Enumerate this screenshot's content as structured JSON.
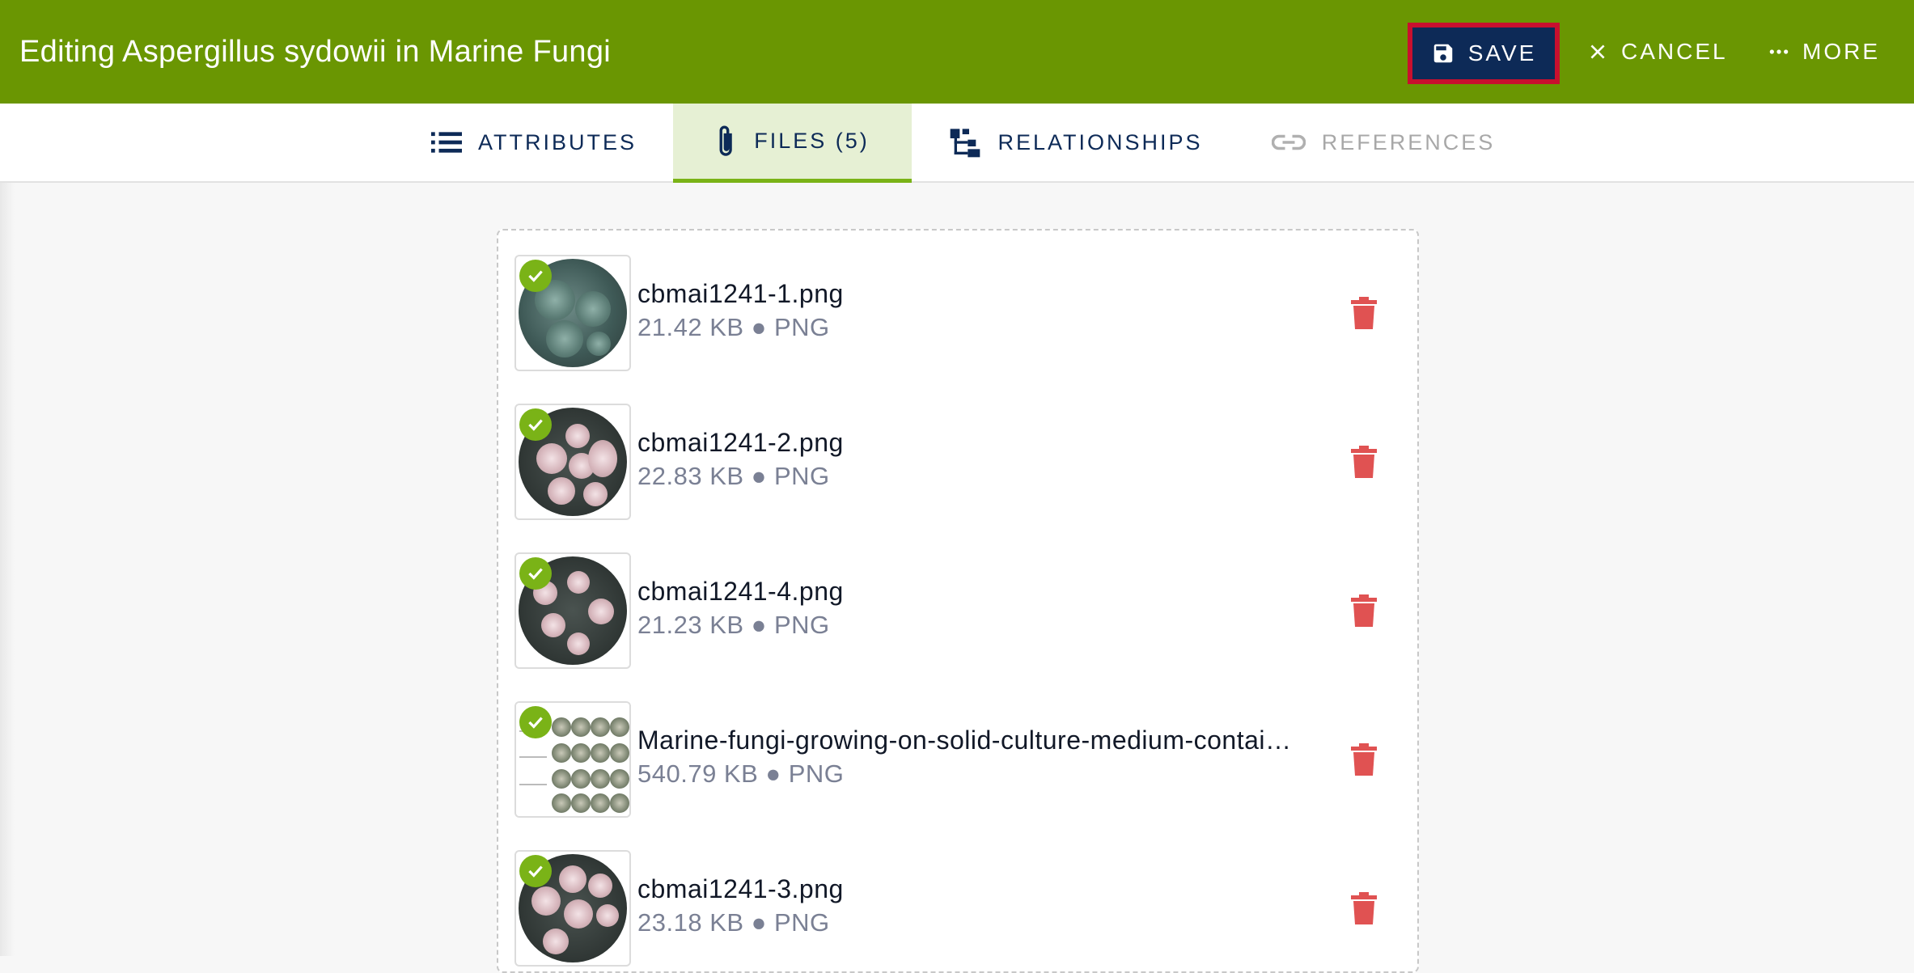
{
  "header": {
    "title": "Editing Aspergillus sydowii in Marine Fungi",
    "save_label": "SAVE",
    "cancel_label": "CANCEL",
    "more_label": "MORE",
    "background_color": "#6a9602",
    "save_color": "#0d2a57"
  },
  "tabs": [
    {
      "label": "ATTRIBUTES",
      "icon": "list-icon",
      "state": "normal"
    },
    {
      "label": "FILES (5)",
      "icon": "paperclip-icon",
      "state": "active"
    },
    {
      "label": "RELATIONSHIPS",
      "icon": "hierarchy-icon",
      "state": "normal"
    },
    {
      "label": "REFERENCES",
      "icon": "link-icon",
      "state": "disabled"
    }
  ],
  "files": [
    {
      "name": "cbmai1241-1.png",
      "meta": "21.42 KB ● PNG",
      "status": "uploaded"
    },
    {
      "name": "cbmai1241-2.png",
      "meta": "22.83 KB ● PNG",
      "status": "uploaded"
    },
    {
      "name": "cbmai1241-4.png",
      "meta": "21.23 KB ● PNG",
      "status": "uploaded"
    },
    {
      "name": "Marine-fungi-growing-on-solid-culture-medium-contai…",
      "meta": "540.79 KB ● PNG",
      "status": "uploaded"
    },
    {
      "name": "cbmai1241-3.png",
      "meta": "23.18 KB ● PNG",
      "status": "uploaded"
    }
  ],
  "colors": {
    "accent": "#7ab317",
    "delete": "#e05252"
  }
}
